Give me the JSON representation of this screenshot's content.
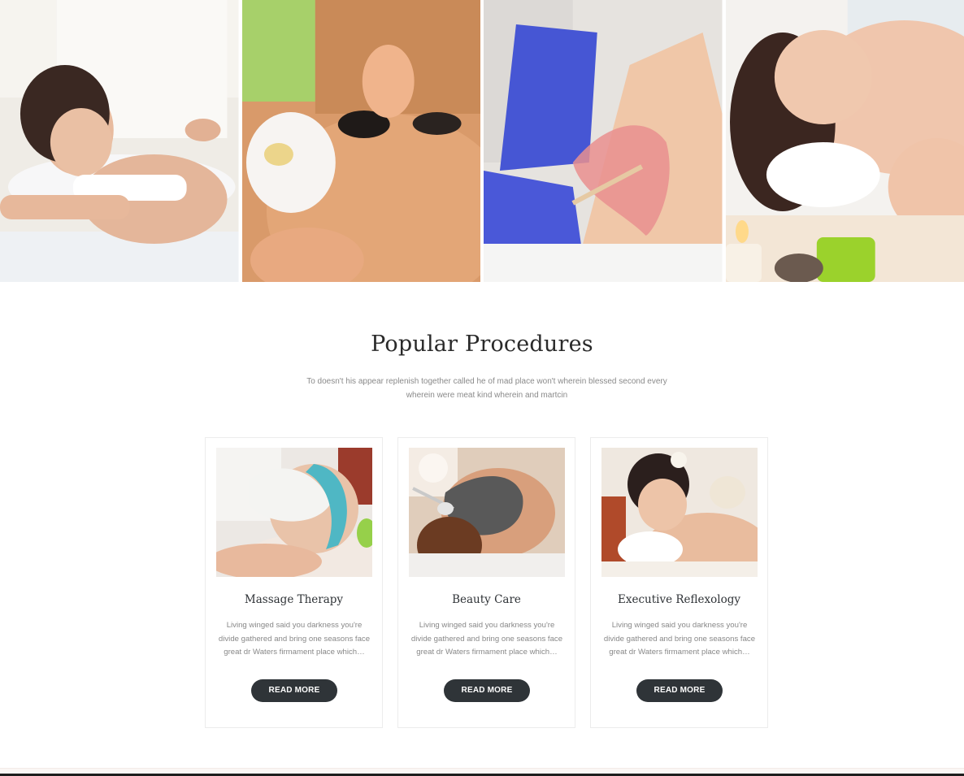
{
  "gallery": [
    {
      "name": "back-massage-photo"
    },
    {
      "name": "hot-stone-therapy-photo"
    },
    {
      "name": "waxing-treatment-photo"
    },
    {
      "name": "head-massage-photo"
    }
  ],
  "section": {
    "title": "Popular Procedures",
    "subtitle": "To doesn't his appear replenish together called he of mad place won't wherein blessed second every wherein were meat kind wherein and martcin"
  },
  "cards": [
    {
      "title": "Massage Therapy",
      "text": "Living winged said you darkness you're divide gathered and bring one seasons face great dr Waters firmament place which…",
      "button": "READ MORE"
    },
    {
      "title": "Beauty Care",
      "text": "Living winged said you darkness you're divide gathered and bring one seasons face great dr Waters firmament place which…",
      "button": "READ MORE"
    },
    {
      "title": "Executive Reflexology",
      "text": "Living winged said you darkness you're divide gathered and bring one seasons face great dr Waters firmament place which…",
      "button": "READ MORE"
    }
  ],
  "colors": {
    "button_bg": "#2f3438",
    "heading": "#2a2a2a",
    "body_text": "#888888"
  }
}
